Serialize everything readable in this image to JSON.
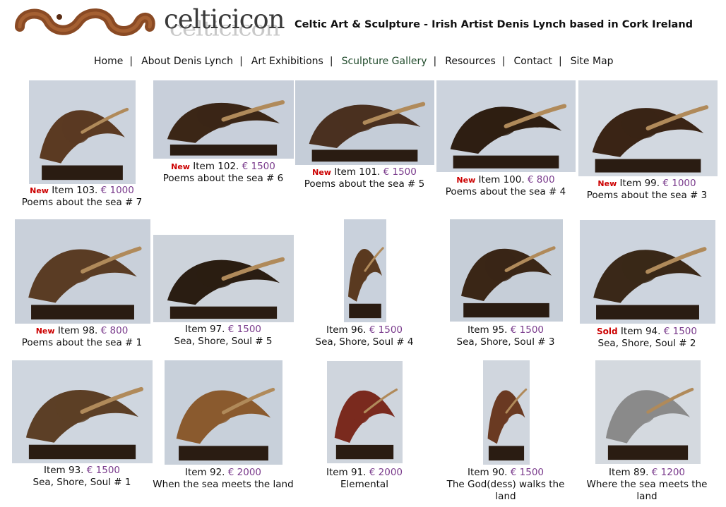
{
  "site": {
    "logo_text": "celticicon",
    "tagline": "Celtic Art & Sculpture - Irish Artist Denis Lynch based in Cork Ireland"
  },
  "nav": {
    "items": [
      {
        "label": "Home"
      },
      {
        "label": "About Denis Lynch"
      },
      {
        "label": "Art Exhibitions"
      },
      {
        "label": "Sculpture Gallery",
        "active": true
      },
      {
        "label": "Resources"
      },
      {
        "label": "Contact"
      },
      {
        "label": "Site Map"
      }
    ],
    "separator": "|"
  },
  "gallery": {
    "items": [
      {
        "badge": "New",
        "item": "Item 103.",
        "price": "€ 1000",
        "title": "Poems about the sea # 7"
      },
      {
        "badge": "New",
        "item": "Item 102.",
        "price": "€ 1500",
        "title": "Poems about the sea # 6"
      },
      {
        "badge": "New",
        "item": "Item 101.",
        "price": "€ 1500",
        "title": "Poems about the sea # 5"
      },
      {
        "badge": "New",
        "item": "Item 100.",
        "price": "€ 800",
        "title": "Poems about the sea # 4"
      },
      {
        "badge": "New",
        "item": "Item 99.",
        "price": "€ 1000",
        "title": "Poems about the sea # 3"
      },
      {
        "badge": "New",
        "item": "Item 98.",
        "price": "€ 800",
        "title": "Poems about the sea # 1"
      },
      {
        "badge": "",
        "item": "Item 97.",
        "price": "€ 1500",
        "title": "Sea, Shore, Soul # 5"
      },
      {
        "badge": "",
        "item": "Item 96.",
        "price": "€ 1500",
        "title": "Sea, Shore, Soul # 4"
      },
      {
        "badge": "",
        "item": "Item 95.",
        "price": "€ 1500",
        "title": "Sea, Shore, Soul # 3"
      },
      {
        "badge": "Sold",
        "item": "Item 94.",
        "price": "€ 1500",
        "title": "Sea, Shore, Soul # 2"
      },
      {
        "badge": "",
        "item": "Item 93.",
        "price": "€ 1500",
        "title": "Sea, Shore, Soul # 1"
      },
      {
        "badge": "",
        "item": "Item 92.",
        "price": "€ 2000",
        "title": "When the sea meets the land"
      },
      {
        "badge": "",
        "item": "Item 91.",
        "price": "€ 2000",
        "title": "Elemental"
      },
      {
        "badge": "",
        "item": "Item 90.",
        "price": "€ 1500",
        "title": "The God(dess) walks the land"
      },
      {
        "badge": "",
        "item": "Item 89.",
        "price": "€ 1200",
        "title": "Where the sea meets the land"
      }
    ]
  }
}
